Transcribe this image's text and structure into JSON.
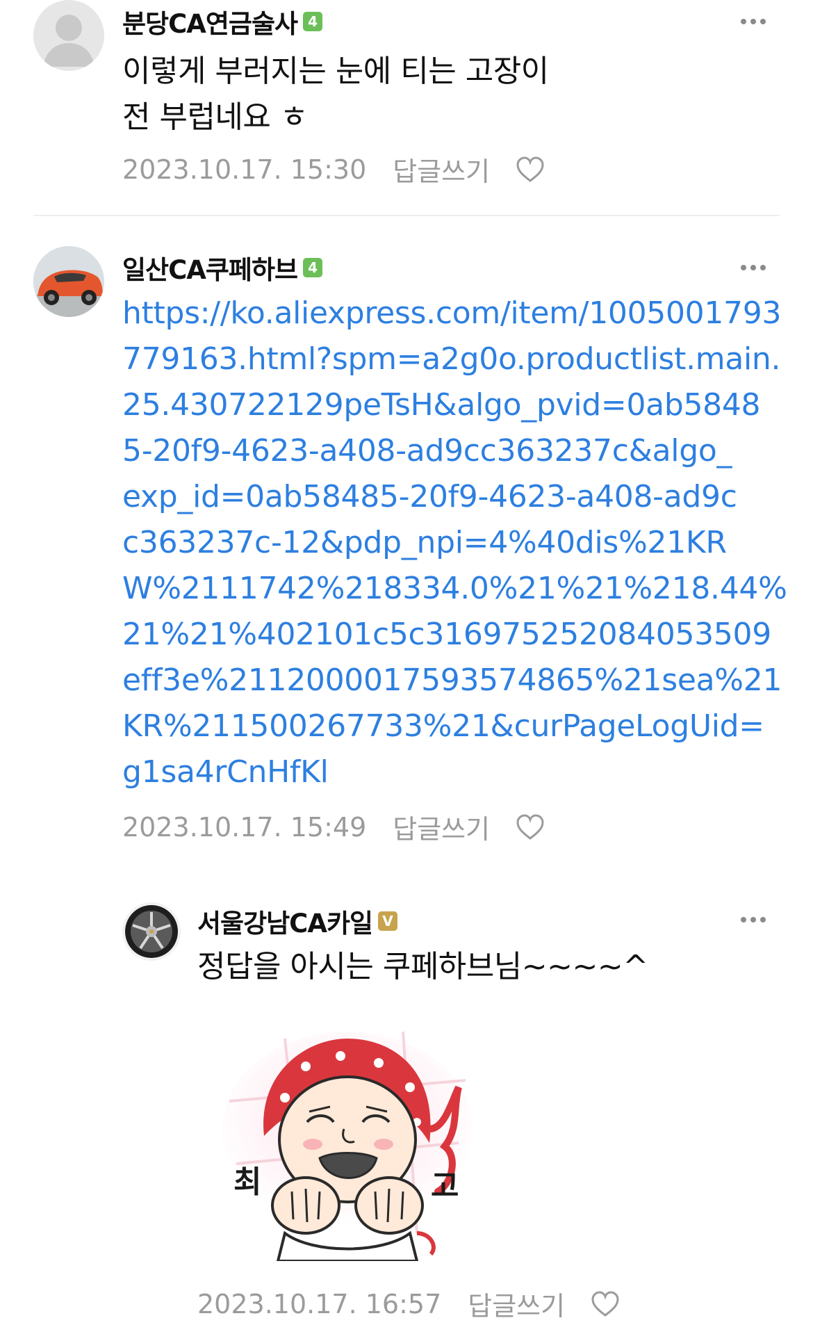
{
  "comments": [
    {
      "author": "분당CA연금술사",
      "badge": "4",
      "text_lines": [
        "이렇게 부러지는 눈에 티는 고장이",
        "전 부럽네요 ㅎ"
      ],
      "timestamp": "2023.10.17. 15:30",
      "reply_label": "답글쓰기"
    },
    {
      "author": "일산CA쿠페하브",
      "badge": "4",
      "link_lines": [
        "https://ko.aliexpress.com/item/1005001793",
        "779163.html?spm=a2g0o.productlist.main.",
        "25.430722129peTsH&algo_pvid=0ab5848",
        "5-20f9-4623-a408-ad9cc363237c&algo_",
        "exp_id=0ab58485-20f9-4623-a408-ad9c",
        "c363237c-12&pdp_npi=4%40dis%21KR",
        "W%2111742%218334.0%21%21%218.44%",
        "21%21%402101c5c31697525208405350­9",
        "eff3e%2112000017593574865%21sea%21",
        "KR%211500267733%21&curPageLogUid=",
        "g1sa4rCnHfKl"
      ],
      "timestamp": "2023.10.17. 15:49",
      "reply_label": "답글쓰기"
    },
    {
      "author": "서울강남CA카일",
      "badge": "V",
      "text": "정답을 아시는 쿠페하브님~~~~^",
      "sticker_text_left": "최",
      "sticker_text_right": "고",
      "timestamp": "2023.10.17. 16:57",
      "reply_label": "답글쓰기"
    }
  ],
  "colors": {
    "link": "#2d7fe0",
    "meta": "#9b9b9b",
    "badge_green": "#6cbf58",
    "badge_gold": "#c8a34d"
  },
  "icons": [
    "more-options-icon",
    "heart-icon",
    "default-avatar-icon"
  ]
}
